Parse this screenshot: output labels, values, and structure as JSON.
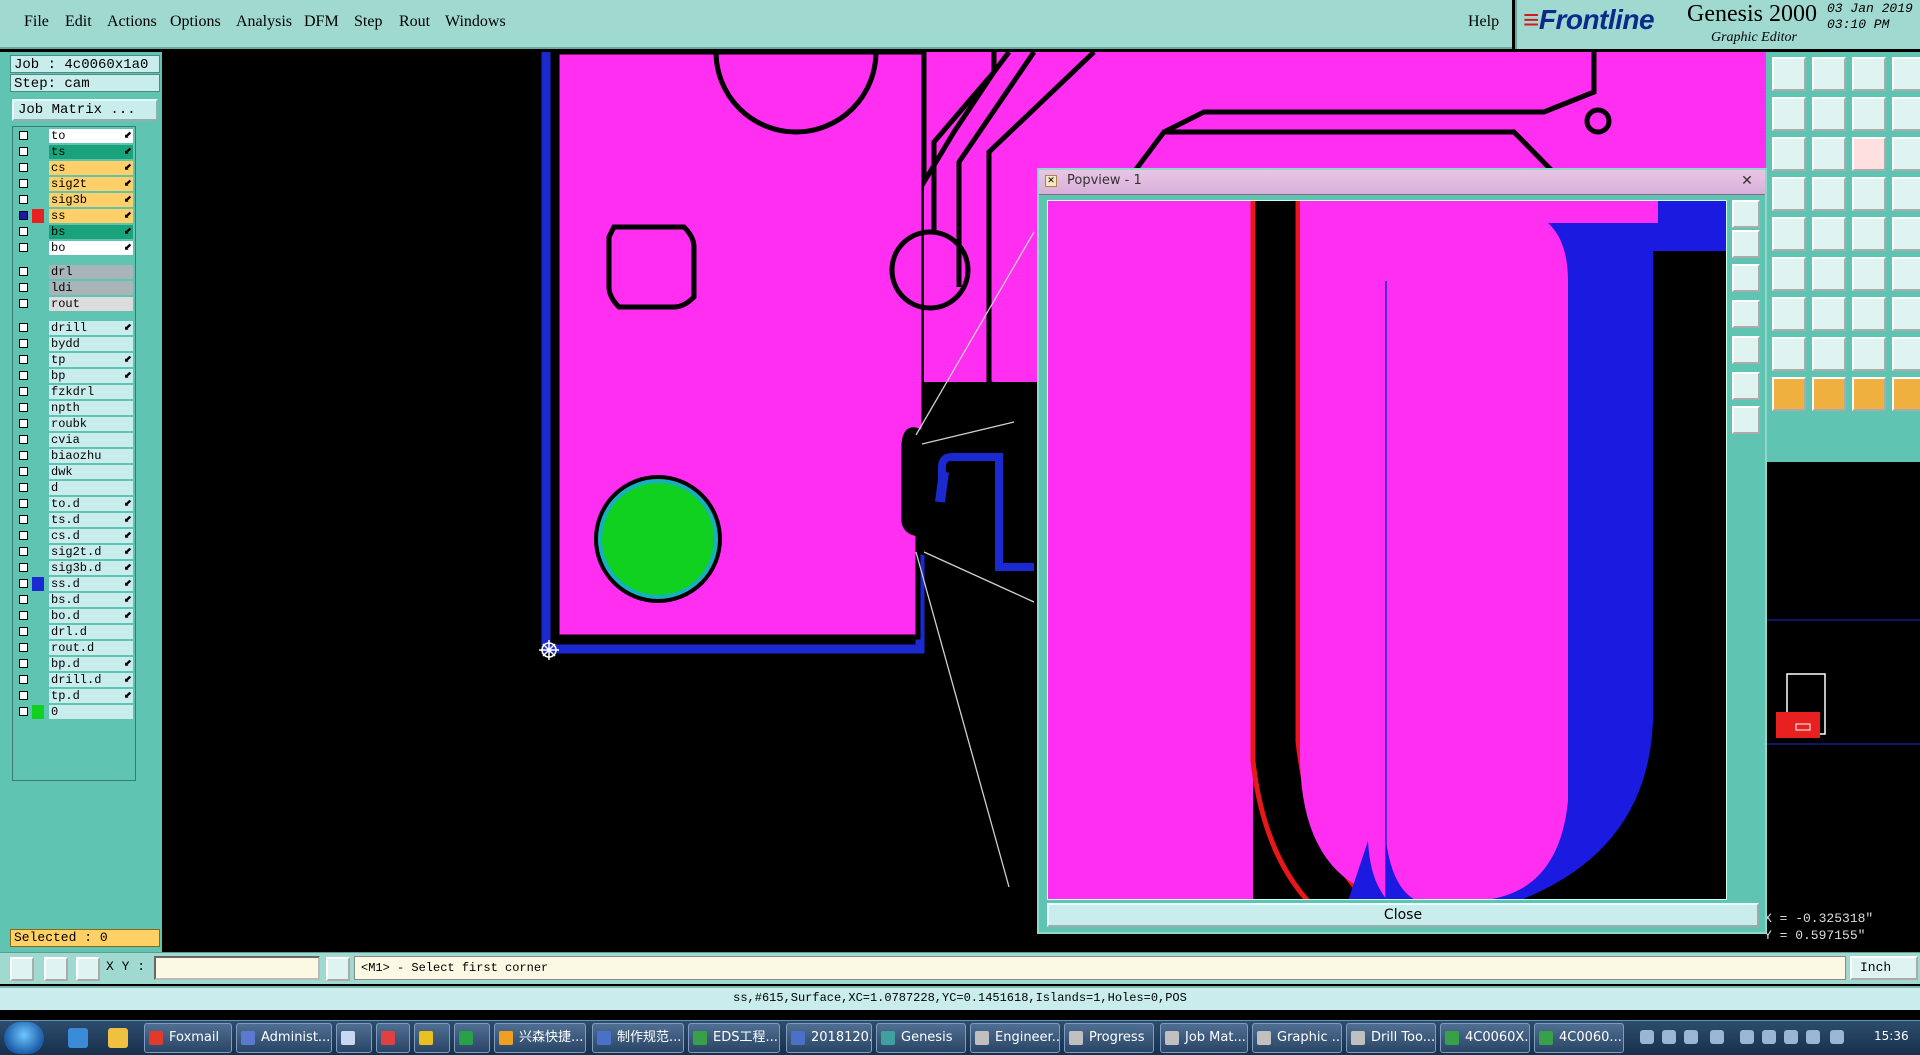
{
  "menubar": {
    "menus": [
      "File",
      "Edit",
      "Actions",
      "Options",
      "Analysis",
      "DFM",
      "Step",
      "Rout",
      "Windows"
    ],
    "help": "Help"
  },
  "brand": {
    "logo": "Frontline",
    "product": "Genesis 2000",
    "subtitle": "Graphic Editor",
    "date": "03 Jan 2019",
    "time": "03:10 PM"
  },
  "job": {
    "job_line": "Job : 4c0060x1a0",
    "step_line": "Step: cam",
    "matrix_button": "Job Matrix ..."
  },
  "layers": [
    {
      "name": "to",
      "bg": "#ffffff",
      "swatch": "",
      "arrow": true
    },
    {
      "name": "ts",
      "bg": "#1aa37a",
      "swatch": "",
      "arrow": true
    },
    {
      "name": "cs",
      "bg": "#ffcf6a",
      "swatch": "",
      "arrow": true
    },
    {
      "name": "sig2t",
      "bg": "#ffcf6a",
      "swatch": "",
      "arrow": true
    },
    {
      "name": "sig3b",
      "bg": "#ffcf6a",
      "swatch": "",
      "arrow": true
    },
    {
      "name": "ss",
      "bg": "#ffcf6a",
      "swatch": "#e82020",
      "arrow": true,
      "selected": true
    },
    {
      "name": "bs",
      "bg": "#1aa37a",
      "swatch": "",
      "arrow": true
    },
    {
      "name": "bo",
      "bg": "#ffffff",
      "swatch": "",
      "arrow": true
    },
    {
      "name": "drl",
      "bg": "#a8b4b8",
      "swatch": "",
      "arrow": false
    },
    {
      "name": "ldi",
      "bg": "#a8b4b8",
      "swatch": "",
      "arrow": false
    },
    {
      "name": "rout",
      "bg": "#dcdcdc",
      "swatch": "",
      "arrow": false
    },
    {
      "name": "drill",
      "bg": "#c9ecec",
      "swatch": "",
      "arrow": true
    },
    {
      "name": "bydd",
      "bg": "#c9ecec",
      "swatch": "",
      "arrow": false
    },
    {
      "name": "tp",
      "bg": "#c9ecec",
      "swatch": "",
      "arrow": true
    },
    {
      "name": "bp",
      "bg": "#c9ecec",
      "swatch": "",
      "arrow": true
    },
    {
      "name": "fzkdrl",
      "bg": "#c9ecec",
      "swatch": "",
      "arrow": false
    },
    {
      "name": "npth",
      "bg": "#c9ecec",
      "swatch": "",
      "arrow": false
    },
    {
      "name": "roubk",
      "bg": "#c9ecec",
      "swatch": "",
      "arrow": false
    },
    {
      "name": "cvia",
      "bg": "#c9ecec",
      "swatch": "",
      "arrow": false
    },
    {
      "name": "biaozhu",
      "bg": "#c9ecec",
      "swatch": "",
      "arrow": false
    },
    {
      "name": "dwk",
      "bg": "#c9ecec",
      "swatch": "",
      "arrow": false
    },
    {
      "name": "d",
      "bg": "#c9ecec",
      "swatch": "",
      "arrow": false
    },
    {
      "name": "to.d",
      "bg": "#c9ecec",
      "swatch": "",
      "arrow": true
    },
    {
      "name": "ts.d",
      "bg": "#c9ecec",
      "swatch": "",
      "arrow": true
    },
    {
      "name": "cs.d",
      "bg": "#c9ecec",
      "swatch": "",
      "arrow": true
    },
    {
      "name": "sig2t.d",
      "bg": "#c9ecec",
      "swatch": "",
      "arrow": true
    },
    {
      "name": "sig3b.d",
      "bg": "#c9ecec",
      "swatch": "",
      "arrow": true
    },
    {
      "name": "ss.d",
      "bg": "#c9ecec",
      "swatch": "#1a2ad0",
      "arrow": true
    },
    {
      "name": "bs.d",
      "bg": "#c9ecec",
      "swatch": "",
      "arrow": true
    },
    {
      "name": "bo.d",
      "bg": "#c9ecec",
      "swatch": "",
      "arrow": true
    },
    {
      "name": "drl.d",
      "bg": "#c9ecec",
      "swatch": "",
      "arrow": false
    },
    {
      "name": "rout.d",
      "bg": "#c9ecec",
      "swatch": "",
      "arrow": false
    },
    {
      "name": "bp.d",
      "bg": "#c9ecec",
      "swatch": "",
      "arrow": true
    },
    {
      "name": "drill.d",
      "bg": "#c9ecec",
      "swatch": "",
      "arrow": true
    },
    {
      "name": "tp.d",
      "bg": "#c9ecec",
      "swatch": "",
      "arrow": true
    },
    {
      "name": "0",
      "bg": "#c9ecec",
      "swatch": "#10d020",
      "arrow": false
    }
  ],
  "selected_label": "Selected : 0",
  "popview": {
    "title": "Popview - 1",
    "close_label": "Close"
  },
  "coords": {
    "x": "X = -0.325318\"",
    "y": "Y = 0.597155\""
  },
  "cmd": {
    "xy_label": "X Y :",
    "xy_value": "",
    "prompt": "<M1> - Select first corner",
    "units": "Inch"
  },
  "status": "ss,#615,Surface,XC=1.0787228,YC=0.1451618,Islands=1,Holes=0,POS",
  "taskbar": {
    "tasks": [
      {
        "label": "Foxmail",
        "color": "#e23a2a"
      },
      {
        "label": "Administ...",
        "color": "#5a7ad0"
      },
      {
        "label": "",
        "color": "#c8d8f0"
      },
      {
        "label": "",
        "color": "#e04040"
      },
      {
        "label": "",
        "color": "#e8c020"
      },
      {
        "label": "",
        "color": "#28a048"
      },
      {
        "label": "兴森快捷...",
        "color": "#f0a020"
      },
      {
        "label": "制作规范...",
        "color": "#4a70c8"
      },
      {
        "label": "EDS工程...",
        "color": "#38a048"
      },
      {
        "label": "2018120...",
        "color": "#4a70c8"
      },
      {
        "label": "Genesis",
        "color": "#40a0a0"
      },
      {
        "label": "Engineer...",
        "color": "#c0c0c0"
      },
      {
        "label": "Progress",
        "color": "#c0c0c0"
      },
      {
        "label": "Job Mat...",
        "color": "#c0c0c0"
      },
      {
        "label": "Graphic ...",
        "color": "#c0c0c0"
      },
      {
        "label": "Drill Too...",
        "color": "#c0c0c0"
      },
      {
        "label": "4C0060X...",
        "color": "#38a048"
      },
      {
        "label": "4C0060...",
        "color": "#38a048"
      }
    ],
    "clock": "15:36"
  }
}
